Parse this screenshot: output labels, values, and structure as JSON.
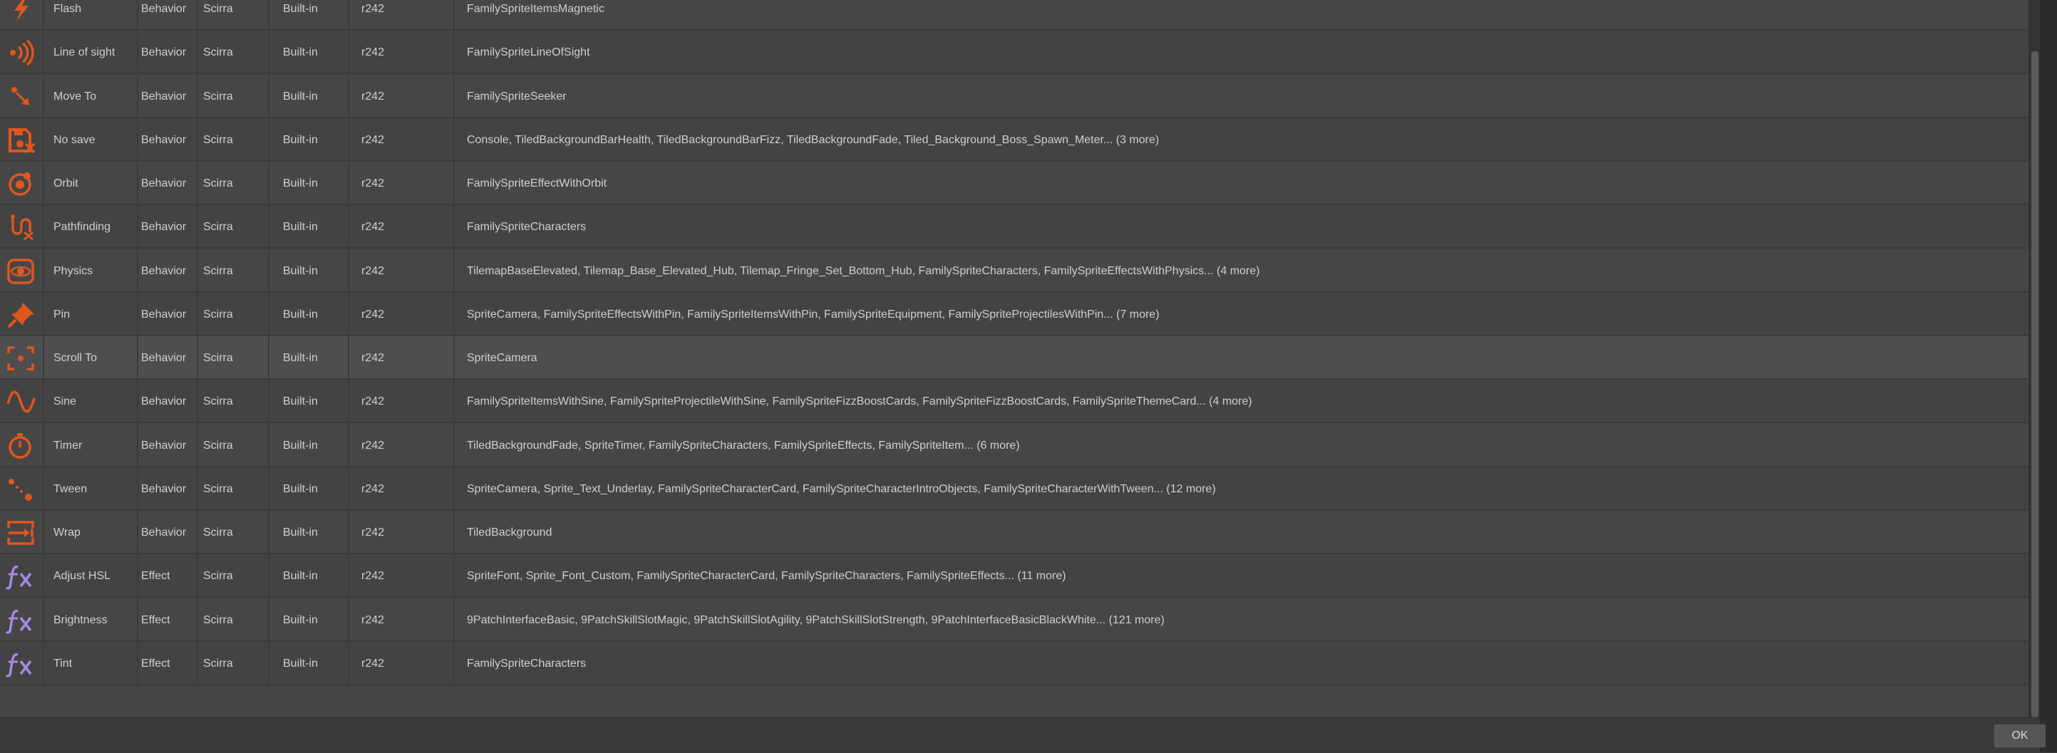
{
  "rows": [
    {
      "name": "Flash",
      "type": "Behavior",
      "author": "Scirra",
      "origin": "Built-in",
      "version": "r242",
      "used_in": "FamilySpriteItemsMagnetic",
      "icon": "flash-icon"
    },
    {
      "name": "Line of sight",
      "type": "Behavior",
      "author": "Scirra",
      "origin": "Built-in",
      "version": "r242",
      "used_in": "FamilySpriteLineOfSight",
      "icon": "line-of-sight-icon"
    },
    {
      "name": "Move To",
      "type": "Behavior",
      "author": "Scirra",
      "origin": "Built-in",
      "version": "r242",
      "used_in": "FamilySpriteSeeker",
      "icon": "move-to-icon"
    },
    {
      "name": "No save",
      "type": "Behavior",
      "author": "Scirra",
      "origin": "Built-in",
      "version": "r242",
      "used_in": "Console, TiledBackgroundBarHealth, TiledBackgroundBarFizz, TiledBackgroundFade, Tiled_Background_Boss_Spawn_Meter... (3 more)",
      "icon": "no-save-icon"
    },
    {
      "name": "Orbit",
      "type": "Behavior",
      "author": "Scirra",
      "origin": "Built-in",
      "version": "r242",
      "used_in": "FamilySpriteEffectWithOrbit",
      "icon": "orbit-icon"
    },
    {
      "name": "Pathfinding",
      "type": "Behavior",
      "author": "Scirra",
      "origin": "Built-in",
      "version": "r242",
      "used_in": "FamilySpriteCharacters",
      "icon": "pathfinding-icon"
    },
    {
      "name": "Physics",
      "type": "Behavior",
      "author": "Scirra",
      "origin": "Built-in",
      "version": "r242",
      "used_in": "TilemapBaseElevated, Tilemap_Base_Elevated_Hub, Tilemap_Fringe_Set_Bottom_Hub, FamilySpriteCharacters, FamilySpriteEffectsWithPhysics... (4 more)",
      "icon": "physics-icon"
    },
    {
      "name": "Pin",
      "type": "Behavior",
      "author": "Scirra",
      "origin": "Built-in",
      "version": "r242",
      "used_in": "SpriteCamera, FamilySpriteEffectsWithPin, FamilySpriteItemsWithPin, FamilySpriteEquipment, FamilySpriteProjectilesWithPin... (7 more)",
      "icon": "pin-icon"
    },
    {
      "name": "Scroll To",
      "type": "Behavior",
      "author": "Scirra",
      "origin": "Built-in",
      "version": "r242",
      "used_in": "SpriteCamera",
      "icon": "scroll-to-icon"
    },
    {
      "name": "Sine",
      "type": "Behavior",
      "author": "Scirra",
      "origin": "Built-in",
      "version": "r242",
      "used_in": "FamilySpriteItemsWithSine, FamilySpriteProjectileWithSine, FamilySpriteFizzBoostCards, FamilySpriteFizzBoostCards, FamilySpriteThemeCard... (4 more)",
      "icon": "sine-icon"
    },
    {
      "name": "Timer",
      "type": "Behavior",
      "author": "Scirra",
      "origin": "Built-in",
      "version": "r242",
      "used_in": "TiledBackgroundFade, SpriteTimer, FamilySpriteCharacters, FamilySpriteEffects, FamilySpriteItem... (6 more)",
      "icon": "timer-icon"
    },
    {
      "name": "Tween",
      "type": "Behavior",
      "author": "Scirra",
      "origin": "Built-in",
      "version": "r242",
      "used_in": "SpriteCamera, Sprite_Text_Underlay, FamilySpriteCharacterCard, FamilySpriteCharacterIntroObjects, FamilySpriteCharacterWithTween... (12 more)",
      "icon": "tween-icon"
    },
    {
      "name": "Wrap",
      "type": "Behavior",
      "author": "Scirra",
      "origin": "Built-in",
      "version": "r242",
      "used_in": "TiledBackground",
      "icon": "wrap-icon"
    },
    {
      "name": "Adjust HSL",
      "type": "Effect",
      "author": "Scirra",
      "origin": "Built-in",
      "version": "r242",
      "used_in": "SpriteFont, Sprite_Font_Custom, FamilySpriteCharacterCard, FamilySpriteCharacters, FamilySpriteEffects... (11 more)",
      "icon": "fx-icon"
    },
    {
      "name": "Brightness",
      "type": "Effect",
      "author": "Scirra",
      "origin": "Built-in",
      "version": "r242",
      "used_in": "9PatchInterfaceBasic, 9PatchSkillSlotMagic, 9PatchSkillSlotAgility, 9PatchSkillSlotStrength, 9PatchInterfaceBasicBlackWhite... (121 more)",
      "icon": "fx-icon"
    },
    {
      "name": "Tint",
      "type": "Effect",
      "author": "Scirra",
      "origin": "Built-in",
      "version": "r242",
      "used_in": "FamilySpriteCharacters",
      "icon": "fx-icon"
    }
  ],
  "footer": {
    "ok_label": "OK"
  },
  "colors": {
    "behavior_icon": "#e0561f",
    "effect_icon": "#a58ae6",
    "background": "#444444"
  }
}
